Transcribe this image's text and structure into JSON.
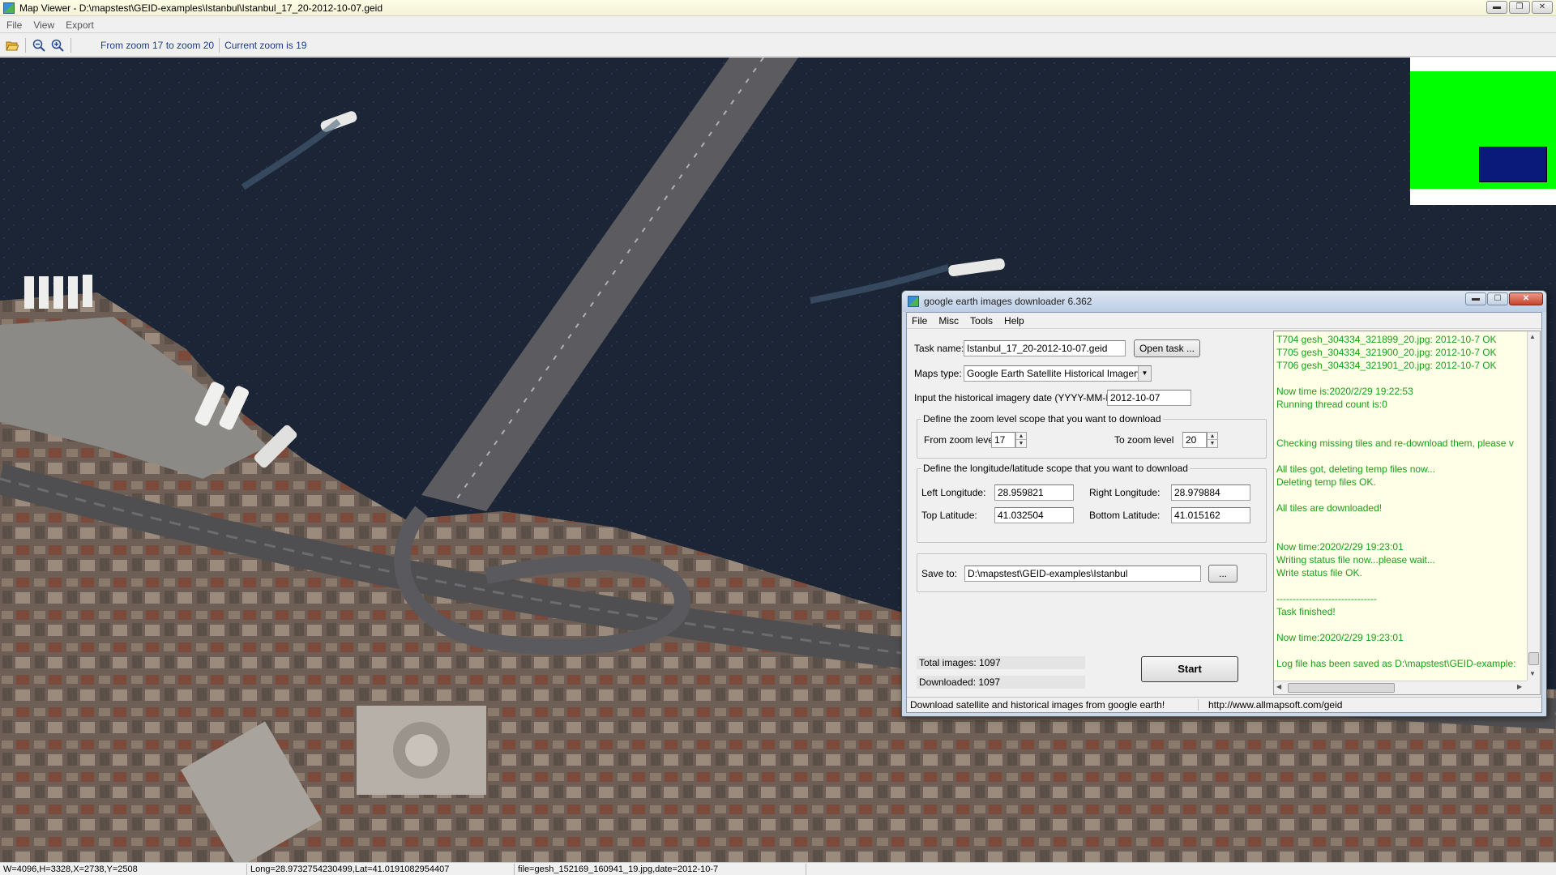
{
  "map_viewer": {
    "title": "Map Viewer - D:\\mapstest\\GEID-examples\\Istanbul\\Istanbul_17_20-2012-10-07.geid",
    "window_buttons": {
      "minimize": "▬",
      "restore": "❐",
      "close": "✕"
    },
    "menu": [
      "File",
      "View",
      "Export"
    ],
    "toolbar": {
      "open_icon": "folder-open-icon",
      "zoom_out_icon": "zoom-out-icon",
      "zoom_in_icon": "zoom-in-icon",
      "zoom_range_text": "From zoom 17 to zoom 20",
      "current_zoom_text": "Current zoom is 19"
    },
    "status": {
      "dimensions": "W=4096,H=3328,X=2738,Y=2508",
      "coords": "Long=28.9732754230499,Lat=41.0191082954407",
      "file": "file=gesh_152169_160941_19.jpg,date=2012-10-7"
    },
    "overview_colors": {
      "background": "#00ff00",
      "viewport": "#0a1a7a"
    }
  },
  "downloader": {
    "title": "google earth images downloader 6.362",
    "window_buttons": {
      "minimize": "▬",
      "maximize": "☐",
      "close": "✕"
    },
    "menu": [
      "File",
      "Misc",
      "Tools",
      "Help"
    ],
    "task_name_label": "Task name:",
    "task_name_value": "Istanbul_17_20-2012-10-07.geid",
    "open_task_label": "Open task ...",
    "maps_type_label": "Maps type:",
    "maps_type_value": "Google Earth Satellite Historical Imagery",
    "date_label": "Input the  historical imagery date (YYYY-MM-DD):",
    "date_value": "2012-10-07",
    "zoom_group_title": "Define the zoom level scope that you want to download",
    "from_zoom_label": "From zoom level",
    "from_zoom_value": "17",
    "to_zoom_label": "To zoom level",
    "to_zoom_value": "20",
    "lonlat_group_title": "Define the longitude/latitude scope that you want to download",
    "left_lon_label": "Left Longitude:",
    "left_lon_value": "28.959821",
    "right_lon_label": "Right Longitude:",
    "right_lon_value": "28.979884",
    "top_lat_label": "Top Latitude:",
    "top_lat_value": "41.032504",
    "bottom_lat_label": "Bottom Latitude:",
    "bottom_lat_value": "41.015162",
    "save_to_label": "Save to:",
    "save_to_value": "D:\\mapstest\\GEID-examples\\Istanbul",
    "browse_label": "...",
    "total_images_text": "Total images: 1097",
    "downloaded_text": "Downloaded: 1097",
    "start_label": "Start",
    "log_lines": [
      "T704 gesh_304334_321899_20.jpg: 2012-10-7 OK",
      "T705 gesh_304334_321900_20.jpg: 2012-10-7 OK",
      "T706 gesh_304334_321901_20.jpg: 2012-10-7 OK",
      "",
      "Now time is:2020/2/29 19:22:53",
      "Running thread count is:0",
      "",
      "",
      "Checking missing tiles and re-download them, please v",
      "",
      "All tiles got, deleting temp files now...",
      "Deleting temp files OK.",
      "",
      "All tiles are downloaded!",
      "",
      "",
      "Now time:2020/2/29 19:23:01",
      "Writing status file now...please wait...",
      "Write status file OK.",
      "",
      "-------------------------------",
      "Task finished!",
      "",
      "Now time:2020/2/29 19:23:01",
      "",
      "Log file has been saved as D:\\mapstest\\GEID-example:"
    ],
    "status_left": "Download satellite and historical  images from google earth!",
    "status_right": "http://www.allmapsoft.com/geid"
  }
}
